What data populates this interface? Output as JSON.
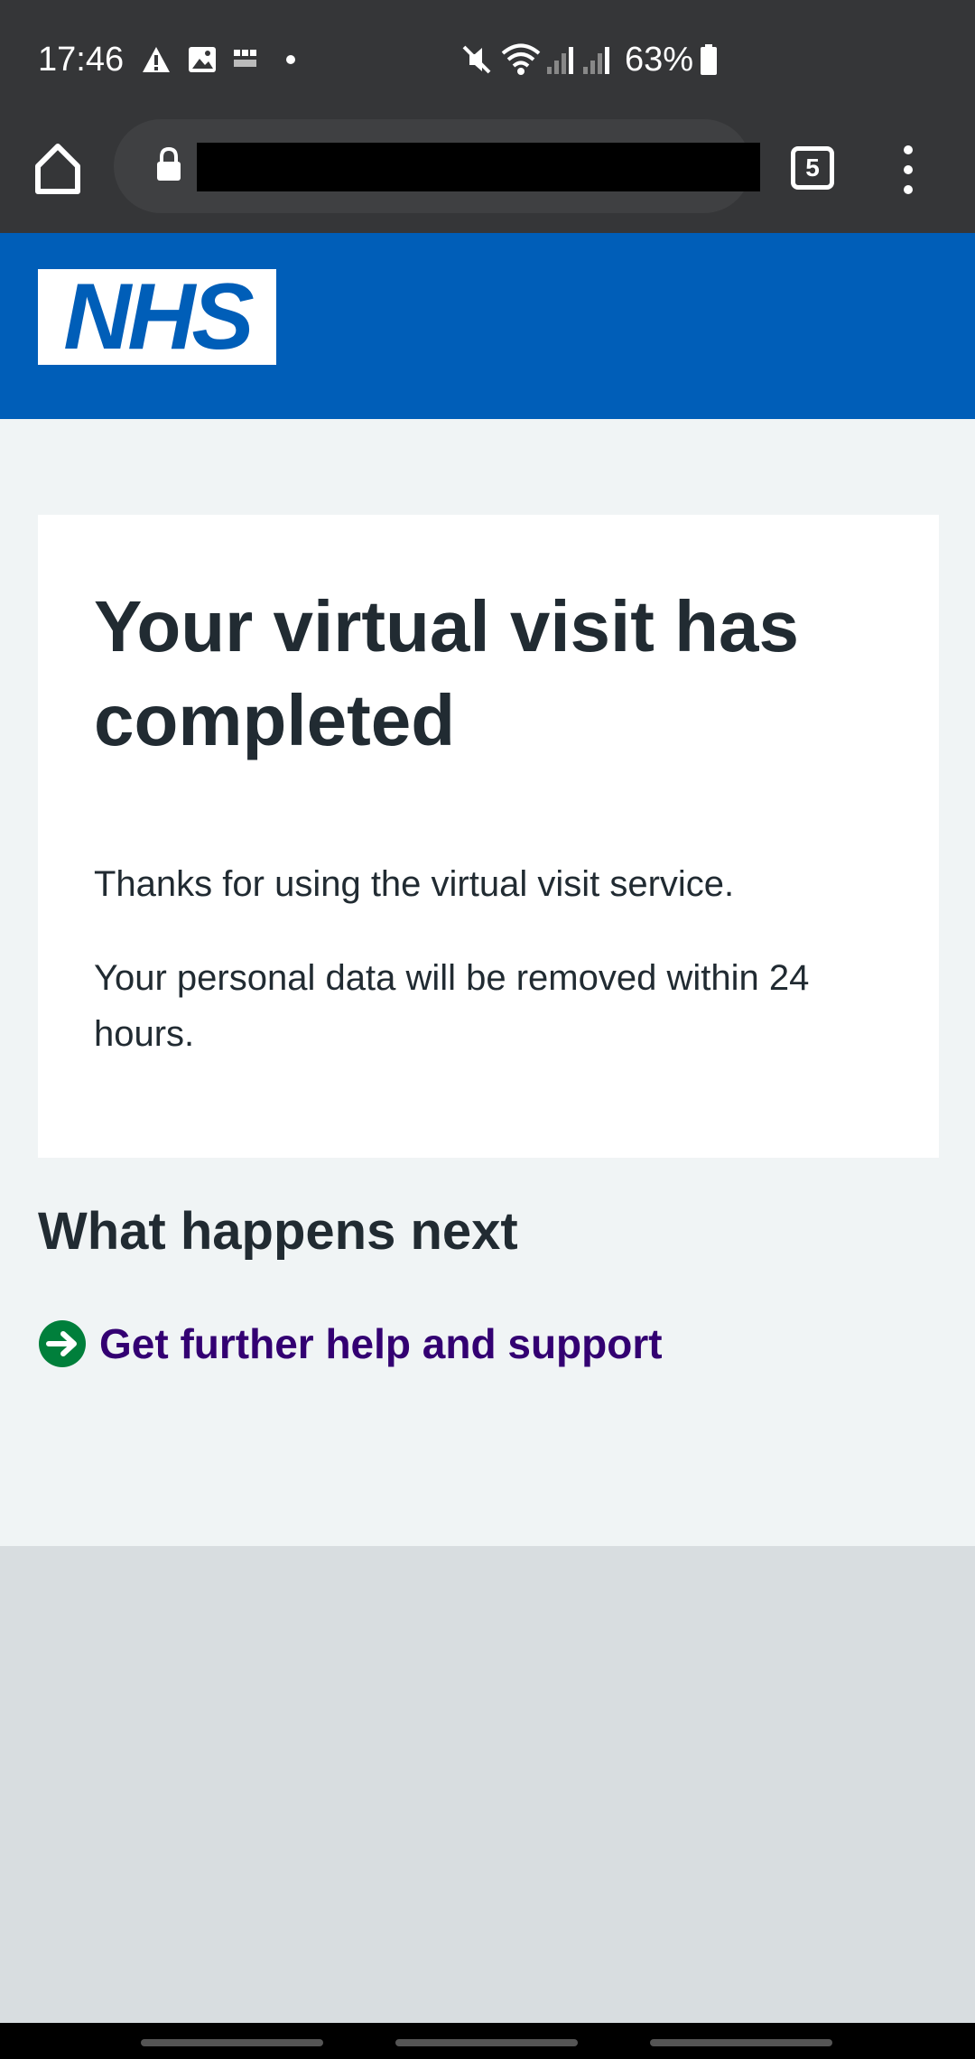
{
  "status_bar": {
    "time": "17:46",
    "battery_percent": "63%",
    "icons": [
      "alert-icon",
      "image-icon",
      "bbc-news-icon",
      "dot-icon",
      "mute-icon",
      "wifi-icon",
      "signal-icon",
      "signal-icon",
      "battery-icon"
    ]
  },
  "browser": {
    "tab_count": "5",
    "url_redacted": true,
    "icons": [
      "home-icon",
      "lock-icon",
      "more-menu-icon"
    ]
  },
  "header": {
    "logo_text": "NHS",
    "brand_color": "#005eb8"
  },
  "panel": {
    "title": "Your virtual visit has completed",
    "paragraph1": "Thanks for using the virtual visit service.",
    "paragraph2": "Your personal data will be removed within 24 hours."
  },
  "next": {
    "heading": "What happens next",
    "link_label": "Get further help and support",
    "link_icon": "arrow-right-circle-icon",
    "link_icon_color": "#007f3b",
    "link_color": "#330072"
  }
}
